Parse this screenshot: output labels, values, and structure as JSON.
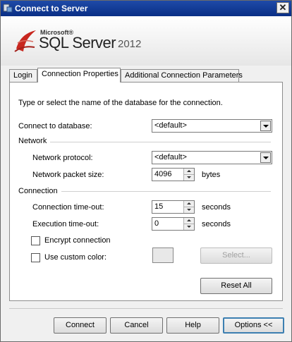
{
  "window": {
    "title": "Connect to Server",
    "close_glyph": "✕"
  },
  "banner": {
    "brand": "Microsoft®",
    "product": "SQL Server",
    "year": "2012",
    "logo_icon": "sql-server-logo-icon"
  },
  "tabs": [
    {
      "label": "Login"
    },
    {
      "label": "Connection Properties"
    },
    {
      "label": "Additional Connection Parameters"
    }
  ],
  "panel": {
    "instruction": "Type or select the name of the database for the connection.",
    "connect_db_label": "Connect to database:",
    "connect_db_value": "<default>",
    "network_group": "Network",
    "protocol_label": "Network protocol:",
    "protocol_value": "<default>",
    "packet_label": "Network packet size:",
    "packet_value": "4096",
    "packet_unit": "bytes",
    "connection_group": "Connection",
    "timeout_label": "Connection time-out:",
    "timeout_value": "15",
    "timeout_unit": "seconds",
    "exec_label": "Execution time-out:",
    "exec_value": "0",
    "exec_unit": "seconds",
    "encrypt_label": "Encrypt connection",
    "custom_color_label": "Use custom color:",
    "select_button": "Select...",
    "reset_button": "Reset All"
  },
  "footer": {
    "connect": "Connect",
    "cancel": "Cancel",
    "help": "Help",
    "options": "Options <<"
  }
}
